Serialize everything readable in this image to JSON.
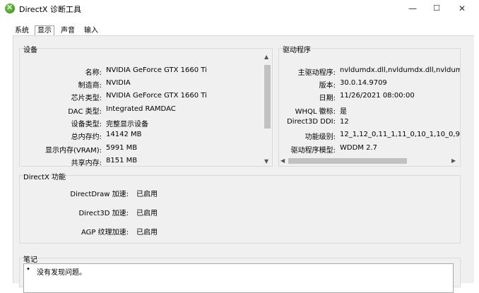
{
  "window": {
    "title": "DirectX 诊断工具",
    "minimize_glyph": "—",
    "maximize_glyph": "☐",
    "close_glyph": "✕"
  },
  "tabs": [
    {
      "label": "系统"
    },
    {
      "label": "显示"
    },
    {
      "label": "声音"
    },
    {
      "label": "输入"
    }
  ],
  "device": {
    "title": "设备",
    "rows": [
      {
        "label": "名称:",
        "value": "NVIDIA GeForce GTX 1660 Ti"
      },
      {
        "label": "制造商:",
        "value": "NVIDIA"
      },
      {
        "label": "芯片类型:",
        "value": "NVIDIA GeForce GTX 1660 Ti"
      },
      {
        "label": "DAC 类型:",
        "value": "Integrated RAMDAC"
      },
      {
        "label": "设备类型:",
        "value": "完整显示设备"
      },
      {
        "label": "总内存约:",
        "value": "14142 MB"
      },
      {
        "label": "显示内存(VRAM):",
        "value": "5991 MB"
      },
      {
        "label": "共享内存:",
        "value": "8151 MB"
      }
    ]
  },
  "driver": {
    "title": "驱动程序",
    "rows": [
      {
        "label": "主驱动程序:",
        "value": "nvldumdx.dll,nvldumdx.dll,nvldumdx.dll,nvld"
      },
      {
        "label": "版本:",
        "value": "30.0.14.9709"
      },
      {
        "label": "日期:",
        "value": "11/26/2021 08:00:00"
      },
      {
        "label": "WHQL 徽标:",
        "value": "是"
      },
      {
        "label": "Direct3D DDI:",
        "value": "12"
      },
      {
        "label": "功能级别:",
        "value": "12_1,12_0,11_1,11_0,10_1,10_0,9_3,9_"
      },
      {
        "label": "驱动程序模型:",
        "value": "WDDM 2.7"
      }
    ]
  },
  "features": {
    "title": "DirectX 功能",
    "rows": [
      {
        "label": "DirectDraw 加速:",
        "value": "已启用"
      },
      {
        "label": "Direct3D 加速:",
        "value": "已启用"
      },
      {
        "label": "AGP 纹理加速:",
        "value": "已启用"
      }
    ]
  },
  "notes": {
    "title": "笔记",
    "bullet": "•",
    "text": "没有发现问题。"
  }
}
